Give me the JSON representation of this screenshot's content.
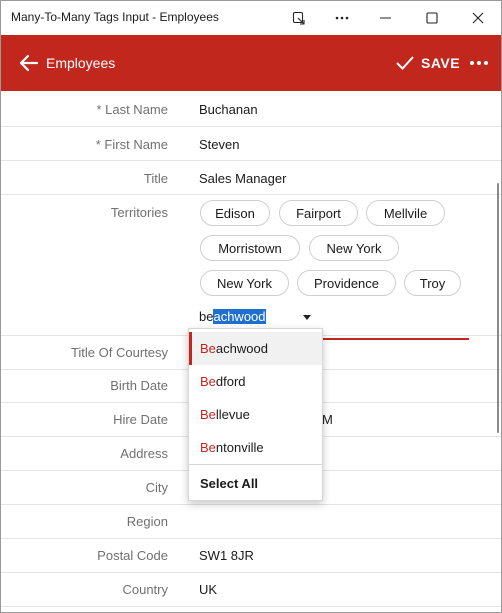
{
  "window": {
    "title": "Many-To-Many Tags Input - Employees"
  },
  "appbar": {
    "title": "Employees",
    "save_label": "SAVE",
    "accent_color": "#c1271c"
  },
  "fields": {
    "last_name": {
      "label": "* Last Name",
      "value": "Buchanan"
    },
    "first_name": {
      "label": "* First Name",
      "value": "Steven"
    },
    "title": {
      "label": "Title",
      "value": "Sales Manager"
    },
    "territories": {
      "label": "Territories"
    },
    "title_of_courtesy": {
      "label": "Title Of Courtesy",
      "value": ""
    },
    "birth_date": {
      "label": "Birth Date",
      "value": ""
    },
    "hire_date": {
      "label": "Hire Date",
      "value": "M"
    },
    "address": {
      "label": "Address",
      "value": ""
    },
    "city": {
      "label": "City",
      "value": ""
    },
    "region": {
      "label": "Region",
      "value": ""
    },
    "postal_code": {
      "label": "Postal Code",
      "value": "SW1 8JR"
    },
    "country": {
      "label": "Country",
      "value": "UK"
    }
  },
  "territory_tags": [
    "Edison",
    "Fairport",
    "Mellvile",
    "Morristown",
    "New York",
    "New York",
    "Providence",
    "Troy"
  ],
  "tag_input": {
    "typed": "be",
    "autocomplete": "achwood"
  },
  "suggestions": {
    "items": [
      {
        "match": "Be",
        "rest": "achwood"
      },
      {
        "match": "Be",
        "rest": "dford"
      },
      {
        "match": "Be",
        "rest": "llevue"
      },
      {
        "match": "Be",
        "rest": "ntonville"
      }
    ],
    "select_all_label": "Select All"
  }
}
